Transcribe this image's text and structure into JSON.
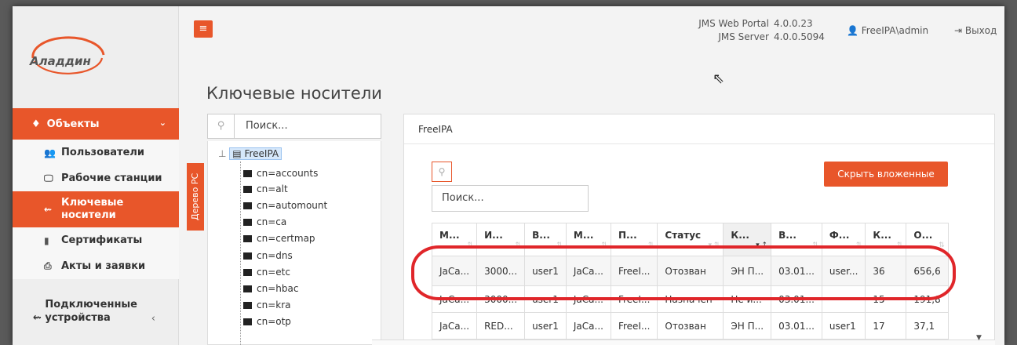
{
  "brand": {
    "logo_text": "Аладдин",
    "accent": "#e8562a",
    "highlight": "#e0262a"
  },
  "header": {
    "menu_icon": "hamburger-icon",
    "portal_label": "JMS Web Portal",
    "portal_version": "4.0.0.23",
    "server_label": "JMS Server",
    "server_version": "4.0.0.5094",
    "user": "FreeIPA\\admin",
    "logout": "Выход"
  },
  "sidebar": {
    "section": "Объекты",
    "items": [
      {
        "label": "Пользователи",
        "icon": "users-icon",
        "glyph": "👥"
      },
      {
        "label": "Рабочие станции",
        "icon": "monitor-icon",
        "glyph": "🖵"
      },
      {
        "label": "Ключевые носители",
        "icon": "usb-icon",
        "glyph": "⇜"
      },
      {
        "label": "Сертификаты",
        "icon": "certificate-icon",
        "glyph": "▮"
      },
      {
        "label": "Акты и заявки",
        "icon": "printer-icon",
        "glyph": "⎙"
      }
    ],
    "devices": "Подключенные устройства"
  },
  "page": {
    "title": "Ключевые носители"
  },
  "tree": {
    "search_placeholder": "Поиск...",
    "tab_label": "Дерево РС",
    "root": "FreeIPA",
    "nodes": [
      "cn=accounts",
      "cn=alt",
      "cn=automount",
      "cn=ca",
      "cn=certmap",
      "cn=dns",
      "cn=etc",
      "cn=hbac",
      "cn=kra",
      "cn=otp"
    ]
  },
  "main": {
    "panel_title": "FreeIPA",
    "search_placeholder": "Поиск...",
    "hide_nested": "Скрыть вложенные",
    "columns": [
      "М...",
      "И...",
      "В...",
      "М...",
      "П...",
      "Статус",
      "К...",
      "В...",
      "Ф...",
      "К...",
      "О..."
    ],
    "rows": [
      [
        "JaCa...",
        "3000...",
        "user1",
        "JaCa...",
        "FreeI...",
        "Отозван",
        "ЭН П...",
        "03.01...",
        "user...",
        "36",
        "656,6"
      ],
      [
        "JaCa...",
        "3000...",
        "user1",
        "JaCa...",
        "FreeI...",
        "Назначен",
        "Не и...",
        "03.01...",
        "",
        "15",
        "191,8"
      ],
      [
        "JaCa...",
        "RED...",
        "user1",
        "JaCa...",
        "FreeI...",
        "Отозван",
        "ЭН П...",
        "03.01...",
        "user1",
        "17",
        "37,1"
      ]
    ]
  }
}
